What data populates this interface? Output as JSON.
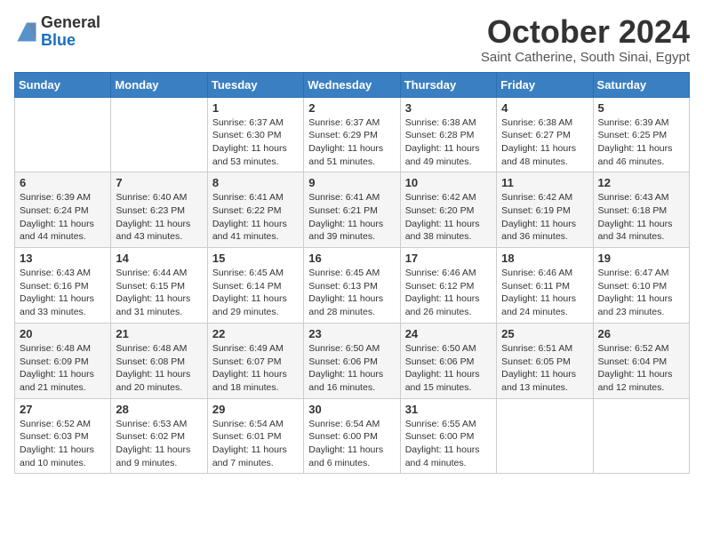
{
  "header": {
    "logo_general": "General",
    "logo_blue": "Blue",
    "month_title": "October 2024",
    "location": "Saint Catherine, South Sinai, Egypt"
  },
  "days_of_week": [
    "Sunday",
    "Monday",
    "Tuesday",
    "Wednesday",
    "Thursday",
    "Friday",
    "Saturday"
  ],
  "weeks": [
    [
      {
        "day": "",
        "info": ""
      },
      {
        "day": "",
        "info": ""
      },
      {
        "day": "1",
        "info": "Sunrise: 6:37 AM\nSunset: 6:30 PM\nDaylight: 11 hours and 53 minutes."
      },
      {
        "day": "2",
        "info": "Sunrise: 6:37 AM\nSunset: 6:29 PM\nDaylight: 11 hours and 51 minutes."
      },
      {
        "day": "3",
        "info": "Sunrise: 6:38 AM\nSunset: 6:28 PM\nDaylight: 11 hours and 49 minutes."
      },
      {
        "day": "4",
        "info": "Sunrise: 6:38 AM\nSunset: 6:27 PM\nDaylight: 11 hours and 48 minutes."
      },
      {
        "day": "5",
        "info": "Sunrise: 6:39 AM\nSunset: 6:25 PM\nDaylight: 11 hours and 46 minutes."
      }
    ],
    [
      {
        "day": "6",
        "info": "Sunrise: 6:39 AM\nSunset: 6:24 PM\nDaylight: 11 hours and 44 minutes."
      },
      {
        "day": "7",
        "info": "Sunrise: 6:40 AM\nSunset: 6:23 PM\nDaylight: 11 hours and 43 minutes."
      },
      {
        "day": "8",
        "info": "Sunrise: 6:41 AM\nSunset: 6:22 PM\nDaylight: 11 hours and 41 minutes."
      },
      {
        "day": "9",
        "info": "Sunrise: 6:41 AM\nSunset: 6:21 PM\nDaylight: 11 hours and 39 minutes."
      },
      {
        "day": "10",
        "info": "Sunrise: 6:42 AM\nSunset: 6:20 PM\nDaylight: 11 hours and 38 minutes."
      },
      {
        "day": "11",
        "info": "Sunrise: 6:42 AM\nSunset: 6:19 PM\nDaylight: 11 hours and 36 minutes."
      },
      {
        "day": "12",
        "info": "Sunrise: 6:43 AM\nSunset: 6:18 PM\nDaylight: 11 hours and 34 minutes."
      }
    ],
    [
      {
        "day": "13",
        "info": "Sunrise: 6:43 AM\nSunset: 6:16 PM\nDaylight: 11 hours and 33 minutes."
      },
      {
        "day": "14",
        "info": "Sunrise: 6:44 AM\nSunset: 6:15 PM\nDaylight: 11 hours and 31 minutes."
      },
      {
        "day": "15",
        "info": "Sunrise: 6:45 AM\nSunset: 6:14 PM\nDaylight: 11 hours and 29 minutes."
      },
      {
        "day": "16",
        "info": "Sunrise: 6:45 AM\nSunset: 6:13 PM\nDaylight: 11 hours and 28 minutes."
      },
      {
        "day": "17",
        "info": "Sunrise: 6:46 AM\nSunset: 6:12 PM\nDaylight: 11 hours and 26 minutes."
      },
      {
        "day": "18",
        "info": "Sunrise: 6:46 AM\nSunset: 6:11 PM\nDaylight: 11 hours and 24 minutes."
      },
      {
        "day": "19",
        "info": "Sunrise: 6:47 AM\nSunset: 6:10 PM\nDaylight: 11 hours and 23 minutes."
      }
    ],
    [
      {
        "day": "20",
        "info": "Sunrise: 6:48 AM\nSunset: 6:09 PM\nDaylight: 11 hours and 21 minutes."
      },
      {
        "day": "21",
        "info": "Sunrise: 6:48 AM\nSunset: 6:08 PM\nDaylight: 11 hours and 20 minutes."
      },
      {
        "day": "22",
        "info": "Sunrise: 6:49 AM\nSunset: 6:07 PM\nDaylight: 11 hours and 18 minutes."
      },
      {
        "day": "23",
        "info": "Sunrise: 6:50 AM\nSunset: 6:06 PM\nDaylight: 11 hours and 16 minutes."
      },
      {
        "day": "24",
        "info": "Sunrise: 6:50 AM\nSunset: 6:06 PM\nDaylight: 11 hours and 15 minutes."
      },
      {
        "day": "25",
        "info": "Sunrise: 6:51 AM\nSunset: 6:05 PM\nDaylight: 11 hours and 13 minutes."
      },
      {
        "day": "26",
        "info": "Sunrise: 6:52 AM\nSunset: 6:04 PM\nDaylight: 11 hours and 12 minutes."
      }
    ],
    [
      {
        "day": "27",
        "info": "Sunrise: 6:52 AM\nSunset: 6:03 PM\nDaylight: 11 hours and 10 minutes."
      },
      {
        "day": "28",
        "info": "Sunrise: 6:53 AM\nSunset: 6:02 PM\nDaylight: 11 hours and 9 minutes."
      },
      {
        "day": "29",
        "info": "Sunrise: 6:54 AM\nSunset: 6:01 PM\nDaylight: 11 hours and 7 minutes."
      },
      {
        "day": "30",
        "info": "Sunrise: 6:54 AM\nSunset: 6:00 PM\nDaylight: 11 hours and 6 minutes."
      },
      {
        "day": "31",
        "info": "Sunrise: 6:55 AM\nSunset: 6:00 PM\nDaylight: 11 hours and 4 minutes."
      },
      {
        "day": "",
        "info": ""
      },
      {
        "day": "",
        "info": ""
      }
    ]
  ]
}
